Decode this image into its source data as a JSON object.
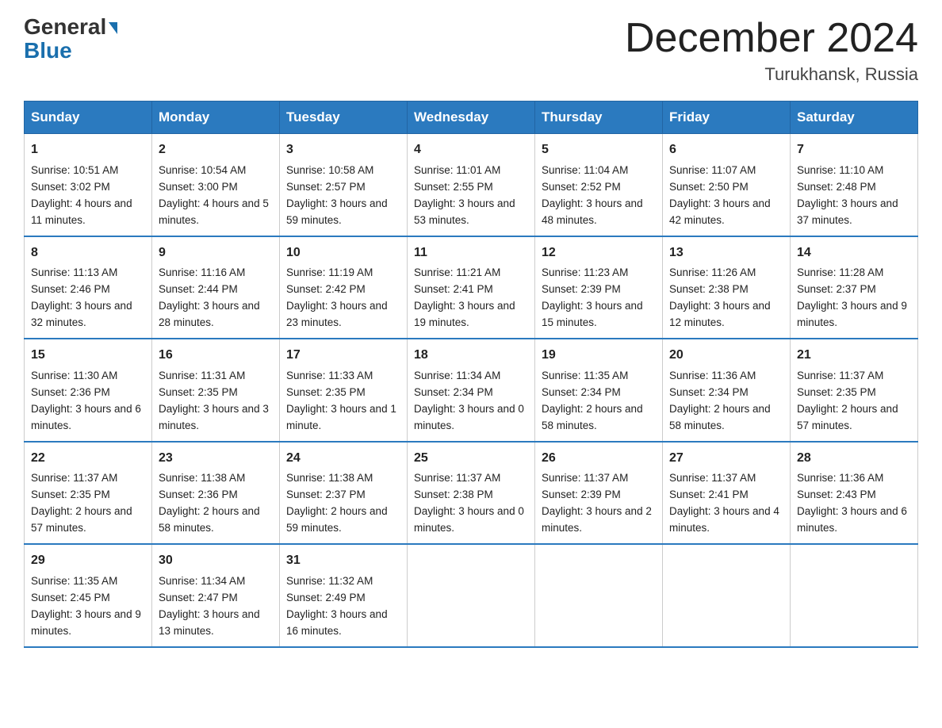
{
  "logo": {
    "line1": "General",
    "line2": "Blue"
  },
  "header": {
    "month": "December 2024",
    "location": "Turukhansk, Russia"
  },
  "days_of_week": [
    "Sunday",
    "Monday",
    "Tuesday",
    "Wednesday",
    "Thursday",
    "Friday",
    "Saturday"
  ],
  "weeks": [
    [
      {
        "day": "1",
        "sunrise": "10:51 AM",
        "sunset": "3:02 PM",
        "daylight": "4 hours and 11 minutes."
      },
      {
        "day": "2",
        "sunrise": "10:54 AM",
        "sunset": "3:00 PM",
        "daylight": "4 hours and 5 minutes."
      },
      {
        "day": "3",
        "sunrise": "10:58 AM",
        "sunset": "2:57 PM",
        "daylight": "3 hours and 59 minutes."
      },
      {
        "day": "4",
        "sunrise": "11:01 AM",
        "sunset": "2:55 PM",
        "daylight": "3 hours and 53 minutes."
      },
      {
        "day": "5",
        "sunrise": "11:04 AM",
        "sunset": "2:52 PM",
        "daylight": "3 hours and 48 minutes."
      },
      {
        "day": "6",
        "sunrise": "11:07 AM",
        "sunset": "2:50 PM",
        "daylight": "3 hours and 42 minutes."
      },
      {
        "day": "7",
        "sunrise": "11:10 AM",
        "sunset": "2:48 PM",
        "daylight": "3 hours and 37 minutes."
      }
    ],
    [
      {
        "day": "8",
        "sunrise": "11:13 AM",
        "sunset": "2:46 PM",
        "daylight": "3 hours and 32 minutes."
      },
      {
        "day": "9",
        "sunrise": "11:16 AM",
        "sunset": "2:44 PM",
        "daylight": "3 hours and 28 minutes."
      },
      {
        "day": "10",
        "sunrise": "11:19 AM",
        "sunset": "2:42 PM",
        "daylight": "3 hours and 23 minutes."
      },
      {
        "day": "11",
        "sunrise": "11:21 AM",
        "sunset": "2:41 PM",
        "daylight": "3 hours and 19 minutes."
      },
      {
        "day": "12",
        "sunrise": "11:23 AM",
        "sunset": "2:39 PM",
        "daylight": "3 hours and 15 minutes."
      },
      {
        "day": "13",
        "sunrise": "11:26 AM",
        "sunset": "2:38 PM",
        "daylight": "3 hours and 12 minutes."
      },
      {
        "day": "14",
        "sunrise": "11:28 AM",
        "sunset": "2:37 PM",
        "daylight": "3 hours and 9 minutes."
      }
    ],
    [
      {
        "day": "15",
        "sunrise": "11:30 AM",
        "sunset": "2:36 PM",
        "daylight": "3 hours and 6 minutes."
      },
      {
        "day": "16",
        "sunrise": "11:31 AM",
        "sunset": "2:35 PM",
        "daylight": "3 hours and 3 minutes."
      },
      {
        "day": "17",
        "sunrise": "11:33 AM",
        "sunset": "2:35 PM",
        "daylight": "3 hours and 1 minute."
      },
      {
        "day": "18",
        "sunrise": "11:34 AM",
        "sunset": "2:34 PM",
        "daylight": "3 hours and 0 minutes."
      },
      {
        "day": "19",
        "sunrise": "11:35 AM",
        "sunset": "2:34 PM",
        "daylight": "2 hours and 58 minutes."
      },
      {
        "day": "20",
        "sunrise": "11:36 AM",
        "sunset": "2:34 PM",
        "daylight": "2 hours and 58 minutes."
      },
      {
        "day": "21",
        "sunrise": "11:37 AM",
        "sunset": "2:35 PM",
        "daylight": "2 hours and 57 minutes."
      }
    ],
    [
      {
        "day": "22",
        "sunrise": "11:37 AM",
        "sunset": "2:35 PM",
        "daylight": "2 hours and 57 minutes."
      },
      {
        "day": "23",
        "sunrise": "11:38 AM",
        "sunset": "2:36 PM",
        "daylight": "2 hours and 58 minutes."
      },
      {
        "day": "24",
        "sunrise": "11:38 AM",
        "sunset": "2:37 PM",
        "daylight": "2 hours and 59 minutes."
      },
      {
        "day": "25",
        "sunrise": "11:37 AM",
        "sunset": "2:38 PM",
        "daylight": "3 hours and 0 minutes."
      },
      {
        "day": "26",
        "sunrise": "11:37 AM",
        "sunset": "2:39 PM",
        "daylight": "3 hours and 2 minutes."
      },
      {
        "day": "27",
        "sunrise": "11:37 AM",
        "sunset": "2:41 PM",
        "daylight": "3 hours and 4 minutes."
      },
      {
        "day": "28",
        "sunrise": "11:36 AM",
        "sunset": "2:43 PM",
        "daylight": "3 hours and 6 minutes."
      }
    ],
    [
      {
        "day": "29",
        "sunrise": "11:35 AM",
        "sunset": "2:45 PM",
        "daylight": "3 hours and 9 minutes."
      },
      {
        "day": "30",
        "sunrise": "11:34 AM",
        "sunset": "2:47 PM",
        "daylight": "3 hours and 13 minutes."
      },
      {
        "day": "31",
        "sunrise": "11:32 AM",
        "sunset": "2:49 PM",
        "daylight": "3 hours and 16 minutes."
      },
      {
        "day": "",
        "sunrise": "",
        "sunset": "",
        "daylight": ""
      },
      {
        "day": "",
        "sunrise": "",
        "sunset": "",
        "daylight": ""
      },
      {
        "day": "",
        "sunrise": "",
        "sunset": "",
        "daylight": ""
      },
      {
        "day": "",
        "sunrise": "",
        "sunset": "",
        "daylight": ""
      }
    ]
  ],
  "labels": {
    "sunrise": "Sunrise:",
    "sunset": "Sunset:",
    "daylight": "Daylight:"
  }
}
